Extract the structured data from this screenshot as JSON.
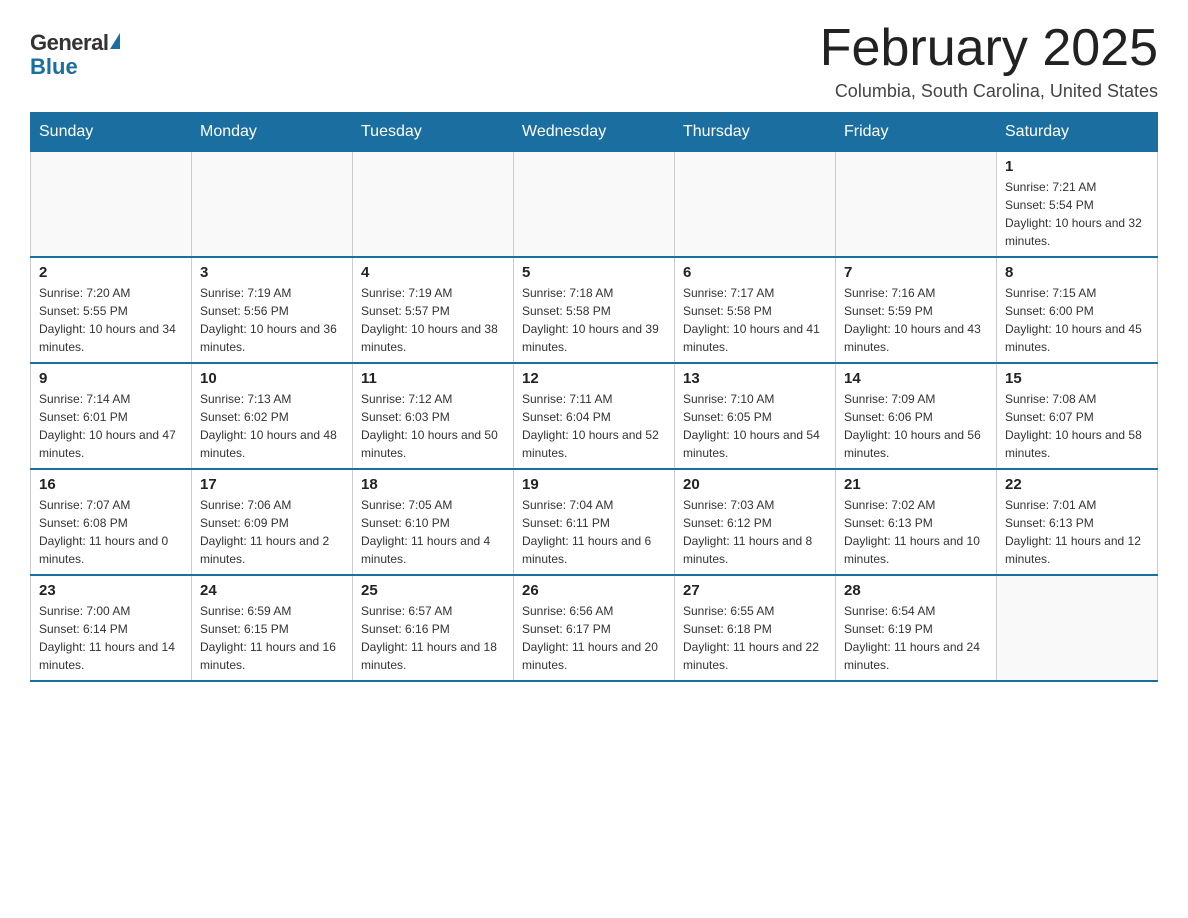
{
  "logo": {
    "general": "General",
    "blue": "Blue"
  },
  "title": {
    "month": "February 2025",
    "location": "Columbia, South Carolina, United States"
  },
  "weekdays": [
    "Sunday",
    "Monday",
    "Tuesday",
    "Wednesday",
    "Thursday",
    "Friday",
    "Saturday"
  ],
  "weeks": [
    [
      {
        "day": "",
        "sunrise": "",
        "sunset": "",
        "daylight": ""
      },
      {
        "day": "",
        "sunrise": "",
        "sunset": "",
        "daylight": ""
      },
      {
        "day": "",
        "sunrise": "",
        "sunset": "",
        "daylight": ""
      },
      {
        "day": "",
        "sunrise": "",
        "sunset": "",
        "daylight": ""
      },
      {
        "day": "",
        "sunrise": "",
        "sunset": "",
        "daylight": ""
      },
      {
        "day": "",
        "sunrise": "",
        "sunset": "",
        "daylight": ""
      },
      {
        "day": "1",
        "sunrise": "Sunrise: 7:21 AM",
        "sunset": "Sunset: 5:54 PM",
        "daylight": "Daylight: 10 hours and 32 minutes."
      }
    ],
    [
      {
        "day": "2",
        "sunrise": "Sunrise: 7:20 AM",
        "sunset": "Sunset: 5:55 PM",
        "daylight": "Daylight: 10 hours and 34 minutes."
      },
      {
        "day": "3",
        "sunrise": "Sunrise: 7:19 AM",
        "sunset": "Sunset: 5:56 PM",
        "daylight": "Daylight: 10 hours and 36 minutes."
      },
      {
        "day": "4",
        "sunrise": "Sunrise: 7:19 AM",
        "sunset": "Sunset: 5:57 PM",
        "daylight": "Daylight: 10 hours and 38 minutes."
      },
      {
        "day": "5",
        "sunrise": "Sunrise: 7:18 AM",
        "sunset": "Sunset: 5:58 PM",
        "daylight": "Daylight: 10 hours and 39 minutes."
      },
      {
        "day": "6",
        "sunrise": "Sunrise: 7:17 AM",
        "sunset": "Sunset: 5:58 PM",
        "daylight": "Daylight: 10 hours and 41 minutes."
      },
      {
        "day": "7",
        "sunrise": "Sunrise: 7:16 AM",
        "sunset": "Sunset: 5:59 PM",
        "daylight": "Daylight: 10 hours and 43 minutes."
      },
      {
        "day": "8",
        "sunrise": "Sunrise: 7:15 AM",
        "sunset": "Sunset: 6:00 PM",
        "daylight": "Daylight: 10 hours and 45 minutes."
      }
    ],
    [
      {
        "day": "9",
        "sunrise": "Sunrise: 7:14 AM",
        "sunset": "Sunset: 6:01 PM",
        "daylight": "Daylight: 10 hours and 47 minutes."
      },
      {
        "day": "10",
        "sunrise": "Sunrise: 7:13 AM",
        "sunset": "Sunset: 6:02 PM",
        "daylight": "Daylight: 10 hours and 48 minutes."
      },
      {
        "day": "11",
        "sunrise": "Sunrise: 7:12 AM",
        "sunset": "Sunset: 6:03 PM",
        "daylight": "Daylight: 10 hours and 50 minutes."
      },
      {
        "day": "12",
        "sunrise": "Sunrise: 7:11 AM",
        "sunset": "Sunset: 6:04 PM",
        "daylight": "Daylight: 10 hours and 52 minutes."
      },
      {
        "day": "13",
        "sunrise": "Sunrise: 7:10 AM",
        "sunset": "Sunset: 6:05 PM",
        "daylight": "Daylight: 10 hours and 54 minutes."
      },
      {
        "day": "14",
        "sunrise": "Sunrise: 7:09 AM",
        "sunset": "Sunset: 6:06 PM",
        "daylight": "Daylight: 10 hours and 56 minutes."
      },
      {
        "day": "15",
        "sunrise": "Sunrise: 7:08 AM",
        "sunset": "Sunset: 6:07 PM",
        "daylight": "Daylight: 10 hours and 58 minutes."
      }
    ],
    [
      {
        "day": "16",
        "sunrise": "Sunrise: 7:07 AM",
        "sunset": "Sunset: 6:08 PM",
        "daylight": "Daylight: 11 hours and 0 minutes."
      },
      {
        "day": "17",
        "sunrise": "Sunrise: 7:06 AM",
        "sunset": "Sunset: 6:09 PM",
        "daylight": "Daylight: 11 hours and 2 minutes."
      },
      {
        "day": "18",
        "sunrise": "Sunrise: 7:05 AM",
        "sunset": "Sunset: 6:10 PM",
        "daylight": "Daylight: 11 hours and 4 minutes."
      },
      {
        "day": "19",
        "sunrise": "Sunrise: 7:04 AM",
        "sunset": "Sunset: 6:11 PM",
        "daylight": "Daylight: 11 hours and 6 minutes."
      },
      {
        "day": "20",
        "sunrise": "Sunrise: 7:03 AM",
        "sunset": "Sunset: 6:12 PM",
        "daylight": "Daylight: 11 hours and 8 minutes."
      },
      {
        "day": "21",
        "sunrise": "Sunrise: 7:02 AM",
        "sunset": "Sunset: 6:13 PM",
        "daylight": "Daylight: 11 hours and 10 minutes."
      },
      {
        "day": "22",
        "sunrise": "Sunrise: 7:01 AM",
        "sunset": "Sunset: 6:13 PM",
        "daylight": "Daylight: 11 hours and 12 minutes."
      }
    ],
    [
      {
        "day": "23",
        "sunrise": "Sunrise: 7:00 AM",
        "sunset": "Sunset: 6:14 PM",
        "daylight": "Daylight: 11 hours and 14 minutes."
      },
      {
        "day": "24",
        "sunrise": "Sunrise: 6:59 AM",
        "sunset": "Sunset: 6:15 PM",
        "daylight": "Daylight: 11 hours and 16 minutes."
      },
      {
        "day": "25",
        "sunrise": "Sunrise: 6:57 AM",
        "sunset": "Sunset: 6:16 PM",
        "daylight": "Daylight: 11 hours and 18 minutes."
      },
      {
        "day": "26",
        "sunrise": "Sunrise: 6:56 AM",
        "sunset": "Sunset: 6:17 PM",
        "daylight": "Daylight: 11 hours and 20 minutes."
      },
      {
        "day": "27",
        "sunrise": "Sunrise: 6:55 AM",
        "sunset": "Sunset: 6:18 PM",
        "daylight": "Daylight: 11 hours and 22 minutes."
      },
      {
        "day": "28",
        "sunrise": "Sunrise: 6:54 AM",
        "sunset": "Sunset: 6:19 PM",
        "daylight": "Daylight: 11 hours and 24 minutes."
      },
      {
        "day": "",
        "sunrise": "",
        "sunset": "",
        "daylight": ""
      }
    ]
  ]
}
